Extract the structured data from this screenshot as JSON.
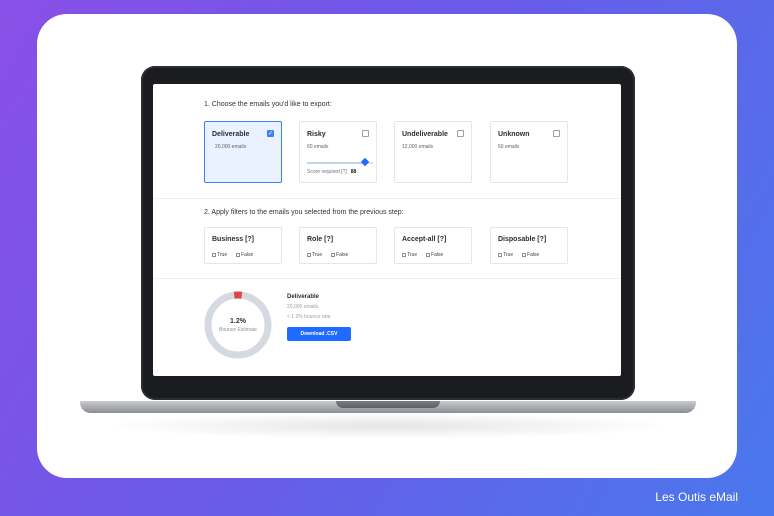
{
  "brand": "Les Outis eMail",
  "steps": {
    "step1": "1. Choose the emails you'd like to export:",
    "step2": "2. Apply filters to the emails you selected from the previous step:"
  },
  "options": [
    {
      "title": "Deliverable",
      "count": "20,000 emails",
      "checked": true
    },
    {
      "title": "Risky",
      "count": "60 emails",
      "checked": false,
      "score_label": "Score required [?]",
      "score_value": "88",
      "score_fraction": 0.88
    },
    {
      "title": "Undeliverable",
      "count": "12,000 emails",
      "checked": false
    },
    {
      "title": "Unknown",
      "count": "50 emails",
      "checked": false
    }
  ],
  "filters": [
    {
      "title": "Business [?]",
      "true_label": "True",
      "false_label": "False"
    },
    {
      "title": "Role [?]",
      "true_label": "True",
      "false_label": "False"
    },
    {
      "title": "Accept-all [?]",
      "true_label": "True",
      "false_label": "False"
    },
    {
      "title": "Disposable [?]",
      "true_label": "True",
      "false_label": "False"
    }
  ],
  "summary": {
    "percent": "1.2%",
    "percent_value": 0.012,
    "estimate_label": "Bounce Estimate",
    "title": "Deliverable",
    "emails": "20,000 emails",
    "bounce_rate": "< 1.2% bounce rate",
    "download_label": "Download .CSV"
  },
  "colors": {
    "accent": "#1f6bff",
    "donut_track": "#d5dae2",
    "donut_bounce": "#e2443f"
  }
}
